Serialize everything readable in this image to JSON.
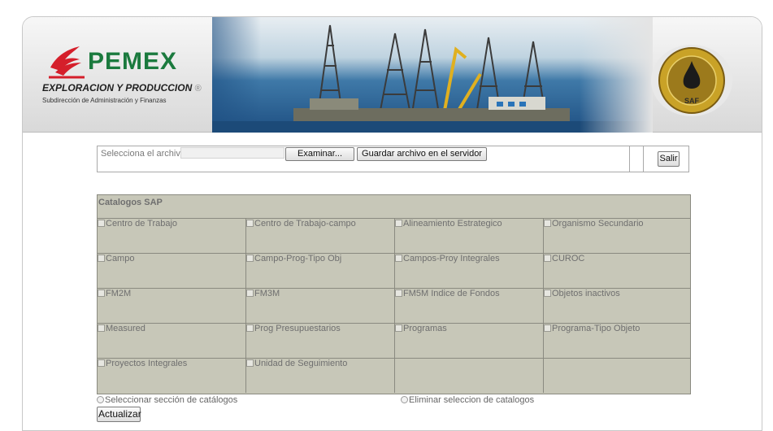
{
  "header": {
    "brand": "PEMEX",
    "division": "EXPLORACION Y PRODUCCION",
    "registered_mark": "®",
    "subdivision": "Subdirección de Administración y Finanzas",
    "seal_text": "SAF"
  },
  "upload": {
    "label": "Selecciona el archivo:",
    "browse_label": "Examinar...",
    "upload_label": "Guardar archivo en el servidor",
    "exit_label": "Salir"
  },
  "catalogs": {
    "title": "Catalogos SAP",
    "items": [
      "Centro de Trabajo",
      "Centro de Trabajo-campo",
      "Alineamiento Estrategico",
      "Organismo Secundario",
      "Campo",
      "Campo-Prog-Tipo Obj",
      "Campos-Proy Integrales",
      "CUROC",
      "FM2M",
      "FM3M",
      "FM5M Indice de Fondos",
      "Objetos inactivos",
      "Measured",
      "Prog Presupuestarios",
      "Programas",
      "Programa-Tipo Objeto",
      "Proyectos Integrales",
      "Unidad de Seguimiento"
    ]
  },
  "options": {
    "select_label": "Seleccionar sección de catálogos",
    "clear_label": "Eliminar seleccion de catalogos"
  },
  "actions": {
    "update_label": "Actualizar"
  },
  "colors": {
    "table_bg": "#c7c7b8",
    "brand_green": "#1b7a3e",
    "brand_red": "#d51f2b",
    "seal_gold": "#c9a227"
  }
}
